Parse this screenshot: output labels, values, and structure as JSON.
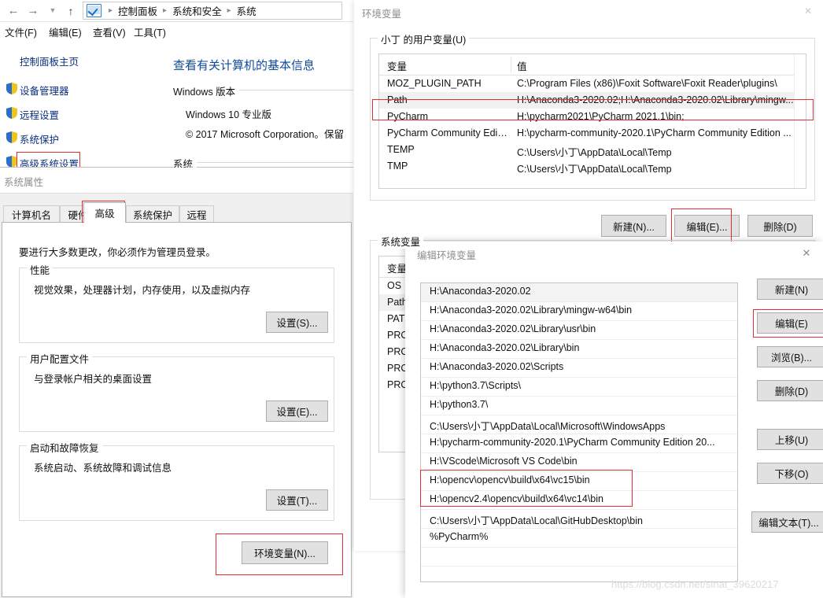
{
  "control_panel": {
    "nav": {
      "back_icon": "arrow-left-icon",
      "forward_icon": "arrow-right-icon",
      "recent_icon": "chevron-down-icon",
      "up_icon": "arrow-up-icon",
      "breadcrumb_icon": "control-panel-icon"
    },
    "breadcrumbs": [
      "控制面板",
      "系统和安全",
      "系统"
    ],
    "menu": [
      "文件(F)",
      "编辑(E)",
      "查看(V)",
      "工具(T)"
    ],
    "sidebar": [
      {
        "label": "控制面板主页",
        "icon": null
      },
      {
        "label": "设备管理器",
        "icon": "shield-icon"
      },
      {
        "label": "远程设置",
        "icon": "shield-icon"
      },
      {
        "label": "系统保护",
        "icon": "shield-icon"
      },
      {
        "label": "高级系统设置",
        "icon": "shield-icon",
        "highlighted": true
      }
    ],
    "page_title": "查看有关计算机的基本信息",
    "section_windows": "Windows 版本",
    "edition": "Windows 10 专业版",
    "copyright": "© 2017 Microsoft Corporation。保留",
    "section_system": "系统"
  },
  "system_properties": {
    "title": "系统属性",
    "tabs": [
      {
        "label": "计算机名",
        "active": false
      },
      {
        "label": "硬件",
        "active": false
      },
      {
        "label": "高级",
        "active": true,
        "highlighted": true
      },
      {
        "label": "系统保护",
        "active": false
      },
      {
        "label": "远程",
        "active": false
      }
    ],
    "intro": "要进行大多数更改，你必须作为管理员登录。",
    "groups": [
      {
        "label": "性能",
        "text": "视觉效果，处理器计划，内存使用，以及虚拟内存",
        "button": "设置(S)..."
      },
      {
        "label": "用户配置文件",
        "text": "与登录帐户相关的桌面设置",
        "button": "设置(E)..."
      },
      {
        "label": "启动和故障恢复",
        "text": "系统启动、系统故障和调试信息",
        "button": "设置(T)..."
      }
    ],
    "env_button": "环境变量(N)..."
  },
  "environment_variables": {
    "title": "环境变量",
    "close_icon": "close-icon",
    "user_section_label": "小丁 的用户变量(U)",
    "columns": [
      "变量",
      "值"
    ],
    "user_variables": [
      {
        "name": "MOZ_PLUGIN_PATH",
        "value": "C:\\Program Files (x86)\\Foxit Software\\Foxit Reader\\plugins\\",
        "selected": false
      },
      {
        "name": "Path",
        "value": "H:\\Anaconda3-2020.02;H:\\Anaconda3-2020.02\\Library\\mingw...",
        "selected": true
      },
      {
        "name": "PyCharm",
        "value": "H:\\pycharm2021\\PyCharm 2021.1\\bin;",
        "selected": false
      },
      {
        "name": "PyCharm Community Editi...",
        "value": "H:\\pycharm-community-2020.1\\PyCharm Community Edition ...",
        "selected": false
      },
      {
        "name": "TEMP",
        "value": "C:\\Users\\小丁\\AppData\\Local\\Temp",
        "selected": false
      },
      {
        "name": "TMP",
        "value": "C:\\Users\\小丁\\AppData\\Local\\Temp",
        "selected": false
      }
    ],
    "user_buttons": [
      {
        "label": "新建(N)...",
        "highlighted": false
      },
      {
        "label": "编辑(E)...",
        "highlighted": true
      },
      {
        "label": "删除(D)",
        "highlighted": false
      }
    ],
    "system_section_label": "系统变量",
    "system_variables": [
      {
        "name": "OS",
        "selected": false
      },
      {
        "name": "Path",
        "selected": true
      },
      {
        "name": "PATH",
        "selected": false
      },
      {
        "name": "PROC",
        "selected": false
      },
      {
        "name": "PROC",
        "selected": false
      },
      {
        "name": "PROC",
        "selected": false
      },
      {
        "name": "PROC",
        "selected": false
      }
    ]
  },
  "edit_environment_variable": {
    "title": "编辑环境变量",
    "close_icon": "close-icon",
    "paths": [
      {
        "value": "H:\\Anaconda3-2020.02",
        "selected": true,
        "highlighted": false
      },
      {
        "value": "H:\\Anaconda3-2020.02\\Library\\mingw-w64\\bin",
        "selected": false,
        "highlighted": false
      },
      {
        "value": "H:\\Anaconda3-2020.02\\Library\\usr\\bin",
        "selected": false,
        "highlighted": false
      },
      {
        "value": "H:\\Anaconda3-2020.02\\Library\\bin",
        "selected": false,
        "highlighted": false
      },
      {
        "value": "H:\\Anaconda3-2020.02\\Scripts",
        "selected": false,
        "highlighted": false
      },
      {
        "value": "H:\\python3.7\\Scripts\\",
        "selected": false,
        "highlighted": false
      },
      {
        "value": "H:\\python3.7\\",
        "selected": false,
        "highlighted": false
      },
      {
        "value": "C:\\Users\\小丁\\AppData\\Local\\Microsoft\\WindowsApps",
        "selected": false,
        "highlighted": false
      },
      {
        "value": "H:\\pycharm-community-2020.1\\PyCharm Community Edition 20...",
        "selected": false,
        "highlighted": false
      },
      {
        "value": "H:\\VScode\\Microsoft VS Code\\bin",
        "selected": false,
        "highlighted": false
      },
      {
        "value": "H:\\opencv\\opencv\\build\\x64\\vc15\\bin",
        "selected": false,
        "highlighted": true
      },
      {
        "value": "H:\\opencv2.4\\opencv\\build\\x64\\vc14\\bin",
        "selected": false,
        "highlighted": true
      },
      {
        "value": "C:\\Users\\小丁\\AppData\\Local\\GitHubDesktop\\bin",
        "selected": false,
        "highlighted": false
      },
      {
        "value": "%PyCharm%",
        "selected": false,
        "highlighted": false
      },
      {
        "value": "",
        "selected": false,
        "highlighted": false
      },
      {
        "value": "",
        "selected": false,
        "highlighted": false
      },
      {
        "value": "",
        "selected": false,
        "highlighted": false
      }
    ],
    "buttons": [
      {
        "label": "新建(N)",
        "highlighted": false
      },
      {
        "label": "编辑(E)",
        "highlighted": true
      },
      {
        "label": "浏览(B)...",
        "highlighted": false
      },
      {
        "label": "删除(D)",
        "highlighted": false
      },
      {
        "label": "上移(U)",
        "highlighted": false
      },
      {
        "label": "下移(O)",
        "highlighted": false
      },
      {
        "label": "编辑文本(T)...",
        "highlighted": false
      }
    ]
  },
  "watermark": "https://blog.csdn.net/sinat_39620217",
  "colors": {
    "accent_link": "#0a2f7d",
    "title_link": "#0f4a9e",
    "highlight_red": "#e03030",
    "dialog_bg": "#f0f0f0",
    "button_bg": "#e1e1e1"
  }
}
